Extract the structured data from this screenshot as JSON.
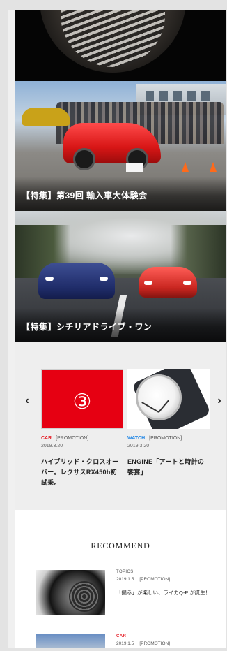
{
  "features": [
    {
      "caption": "【特集】第39回 輸入車大体験会"
    },
    {
      "caption": "【特集】シチリアドライブ・ワン"
    }
  ],
  "carousel": {
    "prev_icon": "chevron-left-icon",
    "next_icon": "chevron-right-icon",
    "prev_glyph": "‹",
    "next_glyph": "›",
    "cards": [
      {
        "badge": "③",
        "category": "CAR",
        "tag": "[PROMOTION]",
        "date": "2019.3.20",
        "title": "ハイブリッド・クロスオーバー。レクサスRX450h初試乗。",
        "category_color": "#e6212a"
      },
      {
        "category": "WATCH",
        "tag": "[PROMOTION]",
        "date": "2019.3.20",
        "title": "ENGINE「アートと時計の饗宴」",
        "category_color": "#2a8be6"
      }
    ]
  },
  "recommend": {
    "title": "RECOMMEND",
    "items": [
      {
        "category": "TOPICS",
        "date": "2019.1.5",
        "tag": "[PROMOTION]",
        "title": "「撮る」が楽しい、ライカQ-P が誕生！"
      },
      {
        "category": "CAR",
        "date": "2019.1.5",
        "tag": "[PROMOTION]",
        "title": ""
      }
    ]
  },
  "colors": {
    "accent_red": "#e60012",
    "page_background": "#e3e3e3",
    "carousel_background": "#eeeeee"
  }
}
